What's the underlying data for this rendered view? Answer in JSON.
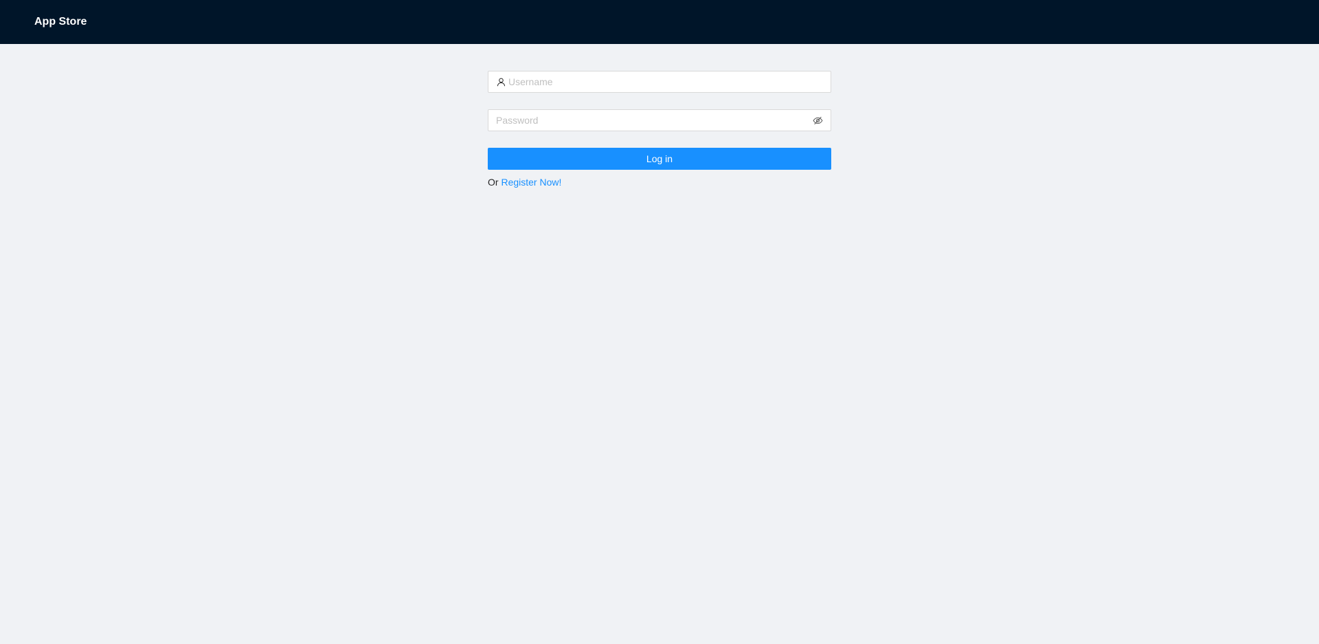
{
  "header": {
    "brand": "App Store"
  },
  "login_form": {
    "username": {
      "value": "",
      "placeholder": "Username",
      "icon": "user-icon"
    },
    "password": {
      "value": "",
      "placeholder": "Password",
      "toggle_icon": "eye-invisible-icon"
    },
    "submit_label": "Log in",
    "register_prefix": "Or",
    "register_link": "Register Now!"
  },
  "colors": {
    "header_bg": "#001529",
    "page_bg": "#f0f2f5",
    "primary": "#1890ff"
  }
}
